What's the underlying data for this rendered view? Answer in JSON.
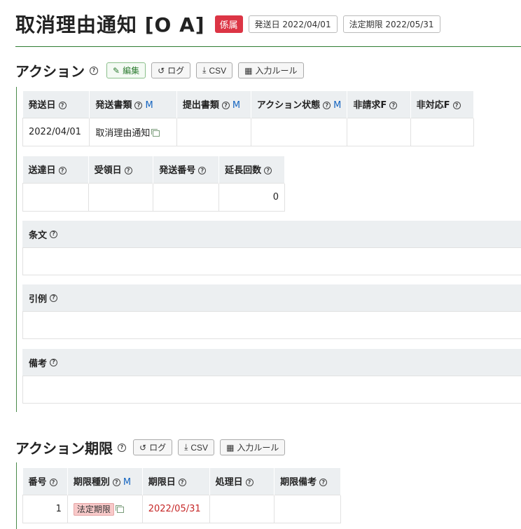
{
  "header": {
    "title": "取消理由通知 [O A]",
    "status_badge": "係属",
    "send_date_badge": "発送日 2022/04/01",
    "deadline_badge": "法定期限 2022/05/31"
  },
  "action": {
    "title": "アクション",
    "buttons": {
      "edit": "編集",
      "log": "ログ",
      "csv": "CSV",
      "input_rule": "入力ルール"
    },
    "table1": {
      "headers": [
        "発送日",
        "発送書類",
        "提出書類",
        "アクション状態",
        "非請求F",
        "非対応F"
      ],
      "m_label": "M",
      "row": [
        "2022/04/01",
        "取消理由通知",
        "",
        "",
        "",
        ""
      ]
    },
    "table2": {
      "headers": [
        "送達日",
        "受領日",
        "発送番号",
        "延長回数"
      ],
      "row": [
        "",
        "",
        "",
        "0"
      ]
    },
    "fields": {
      "article": "条文",
      "citation": "引例",
      "remarks": "備考"
    }
  },
  "deadline": {
    "title": "アクション期限",
    "buttons": {
      "log": "ログ",
      "csv": "CSV",
      "input_rule": "入力ルール"
    },
    "table": {
      "headers": [
        "番号",
        "期限種別",
        "期限日",
        "処理日",
        "期限備考"
      ],
      "row": {
        "no": "1",
        "kind": "法定期限",
        "date": "2022/05/31",
        "processed": "",
        "remarks": ""
      }
    }
  },
  "icons": [
    "help-icon",
    "edit-icon",
    "history-icon",
    "download-icon",
    "table-icon",
    "copy-icon"
  ],
  "colors": {
    "accent_green": "#2e7d32",
    "status_red": "#dc3545",
    "link_blue": "#1565c0",
    "deadline_red": "#c62828"
  }
}
